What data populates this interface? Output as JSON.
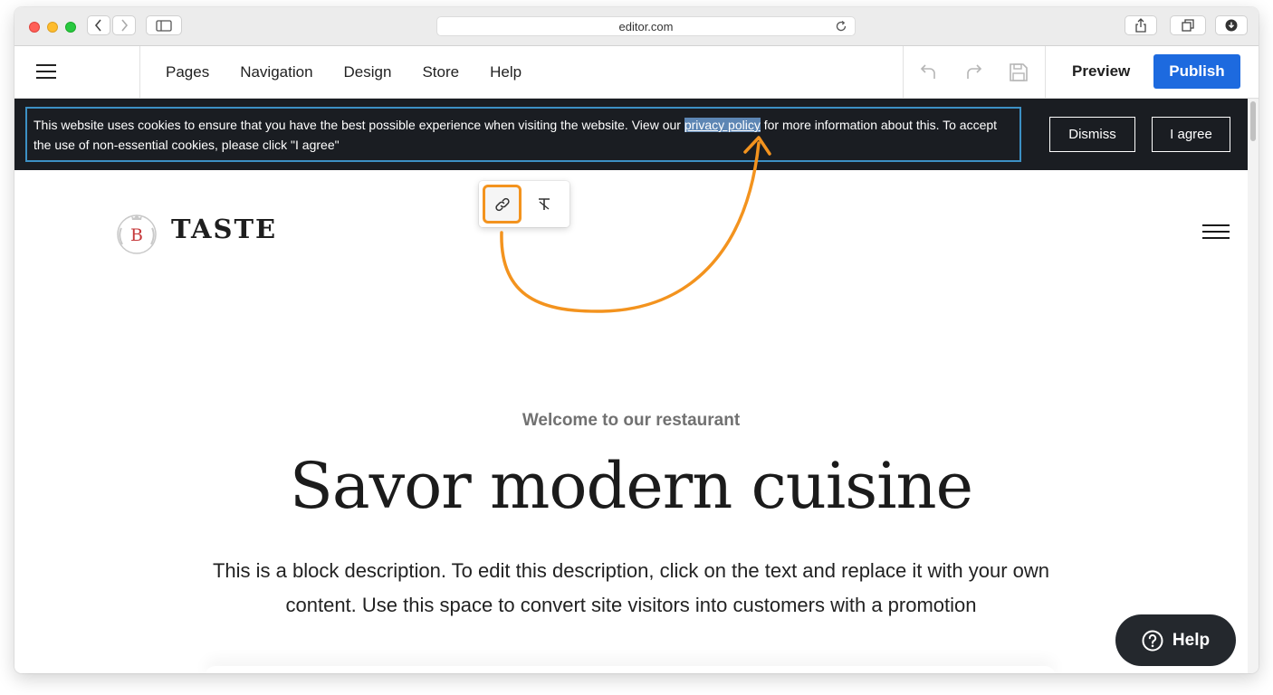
{
  "browser": {
    "url": "editor.com"
  },
  "toolbar": {
    "menu": [
      "Pages",
      "Navigation",
      "Design",
      "Store",
      "Help"
    ],
    "preview_label": "Preview",
    "publish_label": "Publish"
  },
  "cookie_banner": {
    "text_before": "This website uses cookies to ensure that you have the best possible experience when visiting the website. View our ",
    "link_text": "privacy policy",
    "text_after": " for more information about this. To accept the use of non-essential cookies, please click \"I agree\"",
    "dismiss_label": "Dismiss",
    "agree_label": "I agree"
  },
  "site": {
    "logo_letter": "B",
    "brand_name": "TASTE",
    "eyebrow": "Welcome to our restaurant",
    "headline": "Savor modern cuisine",
    "description": "This is a block description. To edit this description, click on the text and replace it with your own content. Use this space to convert site visitors into customers with a promotion"
  },
  "help_widget": {
    "label": "Help"
  },
  "colors": {
    "publish": "#1d6adf",
    "highlight": "#f3931e",
    "cookie_bg": "#1a1d22"
  }
}
